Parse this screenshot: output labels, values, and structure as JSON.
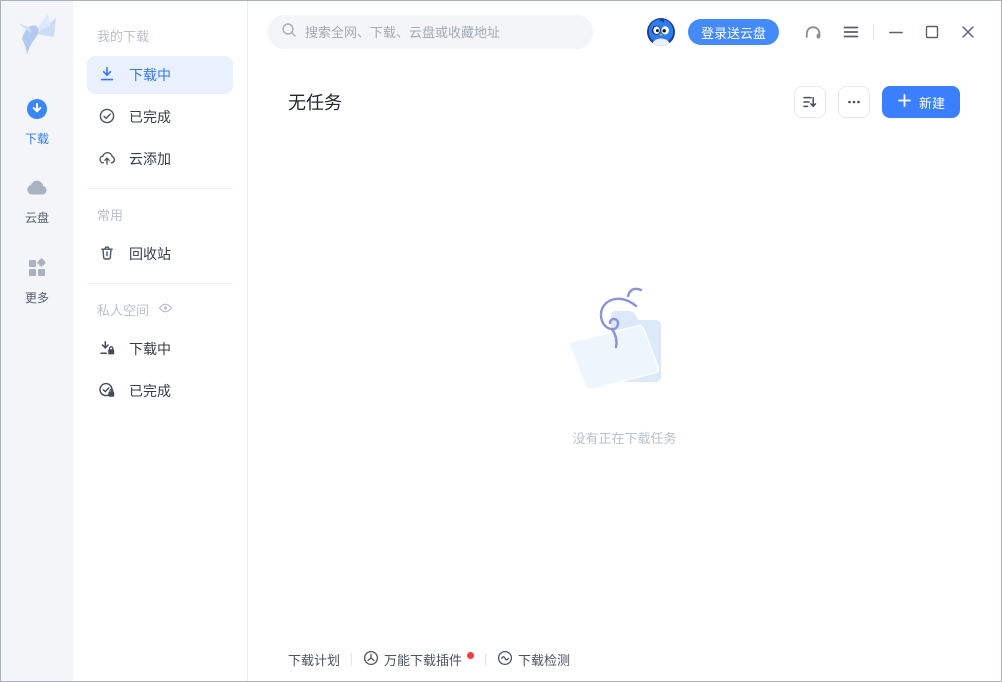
{
  "colors": {
    "accent": "#3b7ffe",
    "accent_light": "#e9f1fe",
    "rail_bg": "#f3f5f8",
    "red_dot": "#fb3b3b",
    "login_button": "#448afb"
  },
  "rail": {
    "items": [
      {
        "label": "下载",
        "icon": "download-circle-icon",
        "active": true
      },
      {
        "label": "云盘",
        "icon": "cloud-icon",
        "active": false
      },
      {
        "label": "更多",
        "icon": "grid-more-icon",
        "active": false
      }
    ]
  },
  "sidebar": {
    "sections": [
      {
        "header": "我的下载",
        "items": [
          {
            "label": "下载中",
            "icon": "download-icon",
            "active": true
          },
          {
            "label": "已完成",
            "icon": "check-circle-icon",
            "active": false
          },
          {
            "label": "云添加",
            "icon": "cloud-add-icon",
            "active": false
          }
        ]
      },
      {
        "header": "常用",
        "items": [
          {
            "label": "回收站",
            "icon": "trash-icon",
            "active": false
          }
        ]
      },
      {
        "header": "私人空间",
        "header_icon": "eye-icon",
        "items": [
          {
            "label": "下载中",
            "icon": "download-lock-icon",
            "active": false
          },
          {
            "label": "已完成",
            "icon": "check-lock-icon",
            "active": false
          }
        ]
      }
    ]
  },
  "topbar": {
    "search_placeholder": "搜索全网、下载、云盘或收藏地址",
    "login_label": "登录送云盘"
  },
  "content": {
    "title": "无任务",
    "new_label": "新建",
    "empty_text": "没有正在下载任务"
  },
  "footer": {
    "plan_label": "下载计划",
    "plugin_label": "万能下载插件",
    "plugin_has_badge": true,
    "detect_label": "下载检测"
  }
}
